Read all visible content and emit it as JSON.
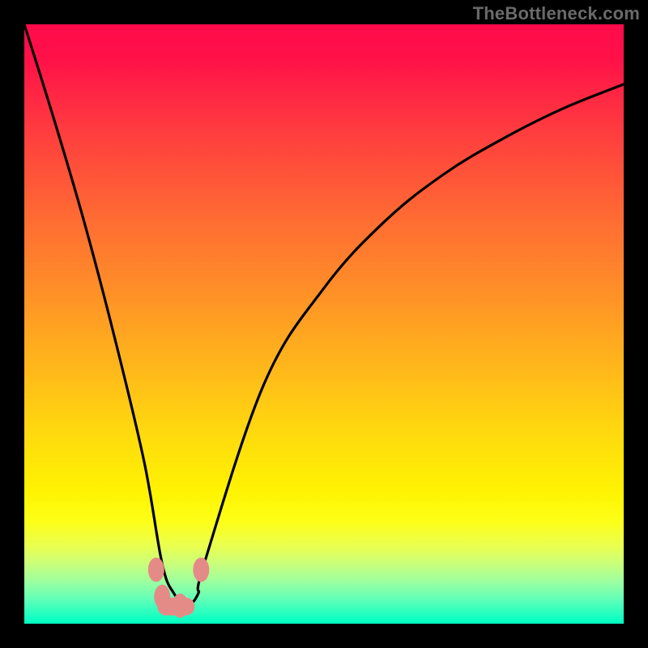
{
  "watermark": "TheBottleneck.com",
  "chart_data": {
    "type": "line",
    "title": "",
    "xlabel": "",
    "ylabel": "",
    "xlim": [
      0,
      100
    ],
    "ylim": [
      0,
      100
    ],
    "grid": false,
    "series": [
      {
        "name": "bottleneck-curve",
        "x": [
          0,
          5,
          10,
          15,
          20,
          23,
          25,
          27,
          29,
          30,
          40,
          50,
          60,
          70,
          80,
          90,
          100
        ],
        "y": [
          100,
          84,
          67,
          48,
          27,
          10,
          5,
          3,
          5,
          10,
          40,
          56,
          67,
          75,
          81,
          86,
          90
        ]
      }
    ],
    "markers": [
      {
        "name": "left-marker-upper",
        "x": 22.0,
        "y": 9.0
      },
      {
        "name": "left-marker-lower",
        "x": 23.0,
        "y": 4.5
      },
      {
        "name": "bottom-marker",
        "x": 26.0,
        "y": 3.0
      },
      {
        "name": "right-marker-upper",
        "x": 29.5,
        "y": 9.0
      }
    ],
    "colors": {
      "curve": "#000000",
      "marker": "#e58b87",
      "gradient_top": "#ff0a4a",
      "gradient_mid": "#ffd90e",
      "gradient_bottom": "#00ffbf"
    }
  }
}
